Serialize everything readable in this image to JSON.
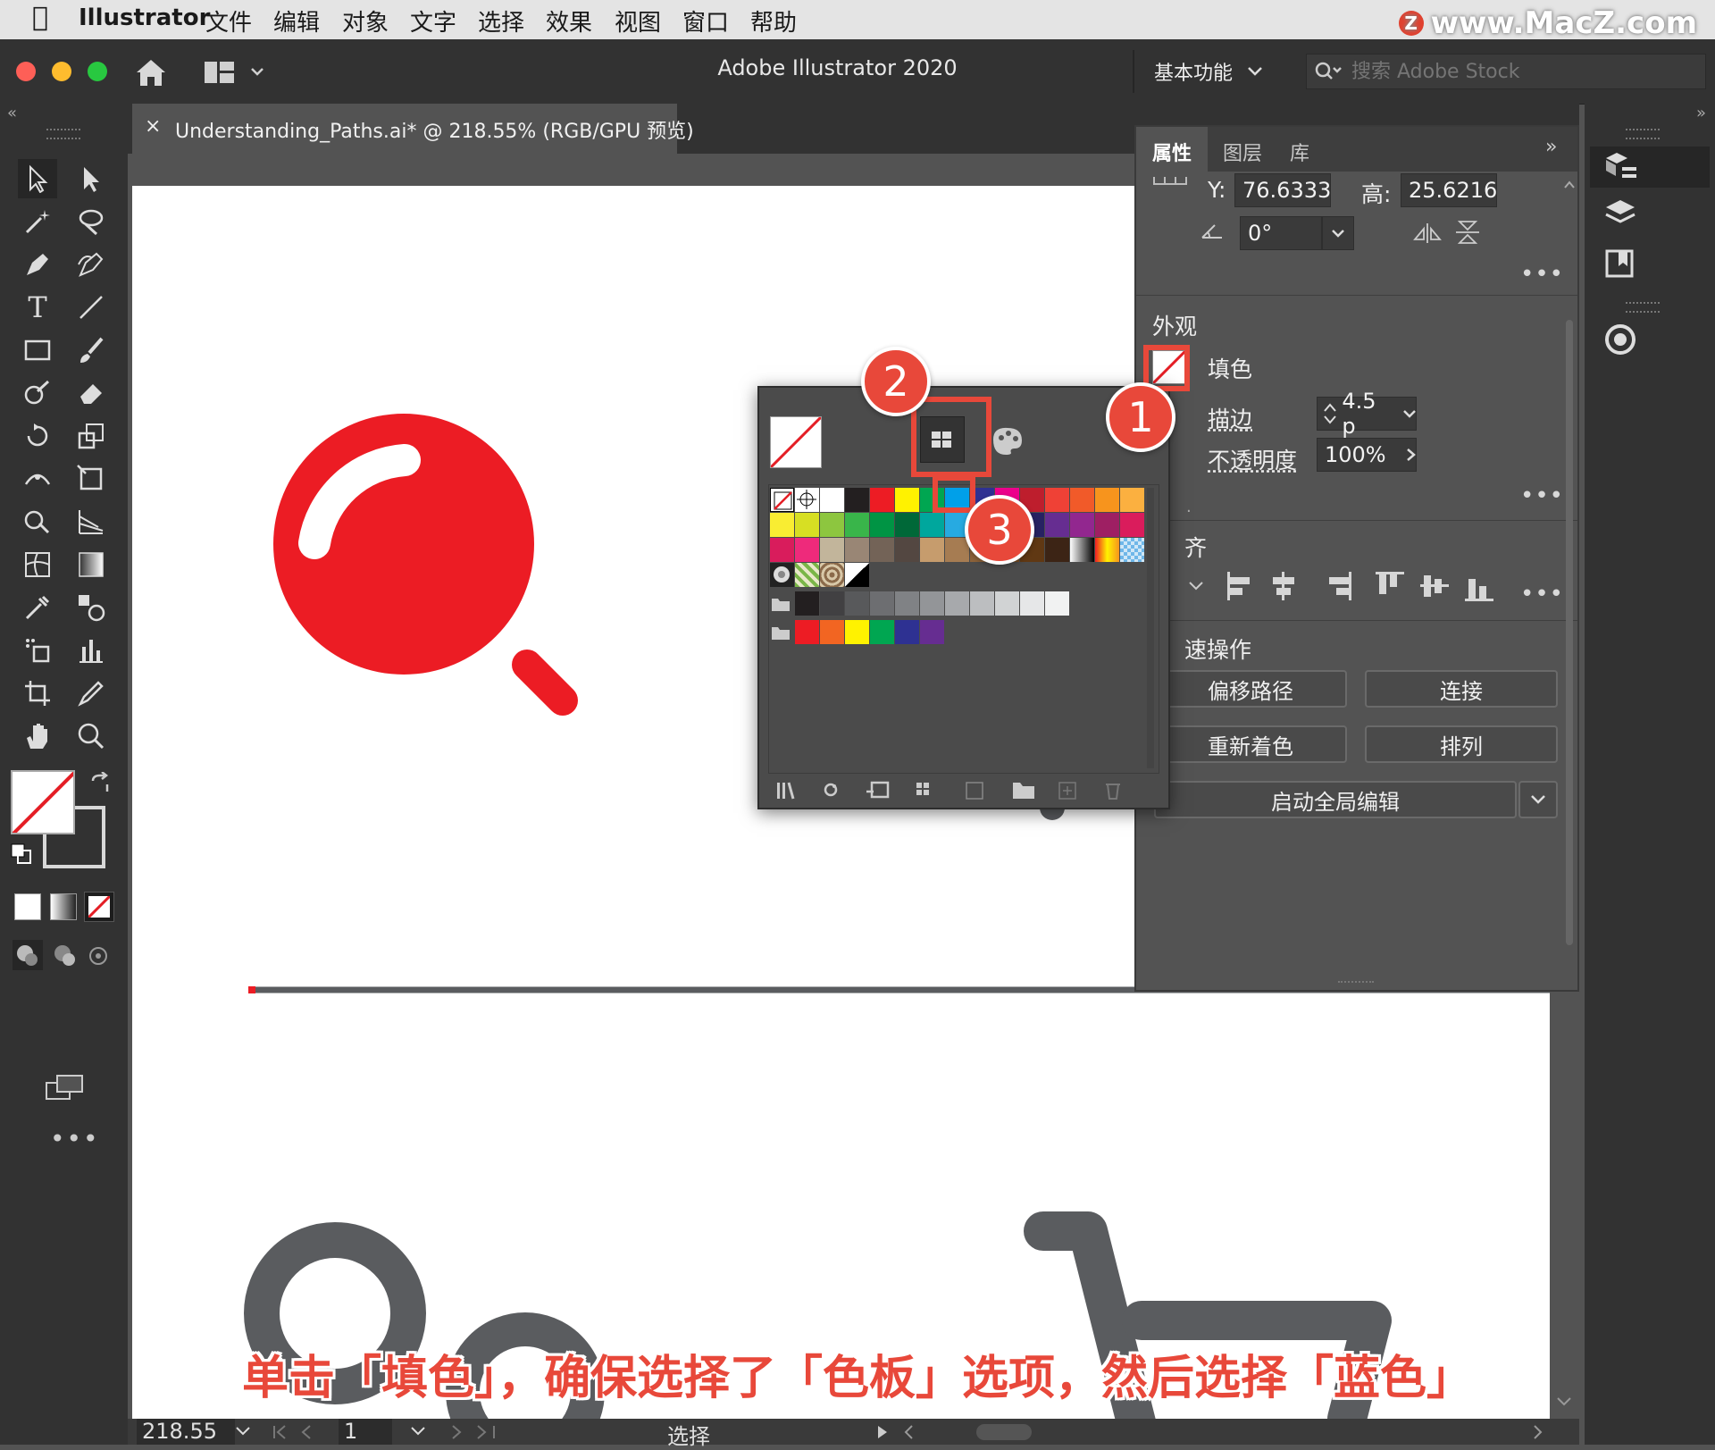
{
  "menubar": {
    "app": "Illustrator",
    "items": [
      "文件",
      "编辑",
      "对象",
      "文字",
      "选择",
      "效果",
      "视图",
      "窗口",
      "帮助"
    ],
    "watermark": "www.MacZ.com",
    "watermark_logo": "Z"
  },
  "titlebar": {
    "title": "Adobe Illustrator 2020",
    "workspace": "基本功能",
    "search_placeholder": "搜索 Adobe Stock"
  },
  "document": {
    "tab_label": "Understanding_Paths.ai* @ 218.55% (RGB/GPU 预览)",
    "close_glyph": "×"
  },
  "properties": {
    "tabs": [
      "属性",
      "图层",
      "库"
    ],
    "y_label": "Y:",
    "y_value": "76.6333",
    "h_label": "高:",
    "h_value": "25.6216",
    "angle_value": "0°",
    "appearance_title": "外观",
    "fill_label": "填色",
    "stroke_label": "描边",
    "stroke_value": "4.5 p",
    "opacity_label": "不透明度",
    "opacity_value": "100%",
    "align_partial": "齐",
    "quick_actions_partial": "速操作",
    "buttons": {
      "offset_path": "偏移路径",
      "join": "连接",
      "recolor": "重新着色",
      "arrange": "排列",
      "global_edit": "启动全局编辑"
    }
  },
  "callouts": [
    "1",
    "2",
    "3"
  ],
  "caption": "单击「填色」，确保选择了「色板」选项，然后选择「蓝色」",
  "statusbar": {
    "zoom": "218.55",
    "page": "1",
    "mode": "选择"
  },
  "colors": {
    "accent_red": "#e8483a",
    "artwork_red": "#ec1c24",
    "artwork_gray": "#5a5c5f",
    "selected_swatch_blue": "#00a0e9"
  }
}
